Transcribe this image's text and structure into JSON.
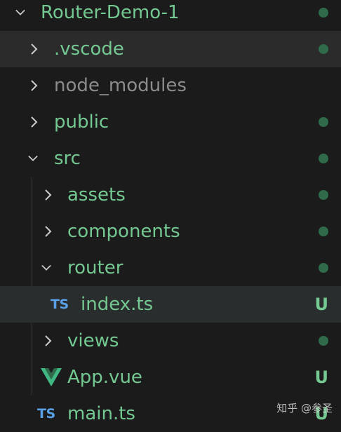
{
  "explorer": {
    "items": [
      {
        "label": "Router-Demo-1",
        "color": "#73c991",
        "status": "dot"
      },
      {
        "label": ".vscode",
        "color": "#73c991",
        "status": "dot"
      },
      {
        "label": "node_modules",
        "color": "#8c8c8c",
        "status": "none"
      },
      {
        "label": "public",
        "color": "#73c991",
        "status": "dot"
      },
      {
        "label": "src",
        "color": "#73c991",
        "status": "dot"
      },
      {
        "label": "assets",
        "color": "#73c991",
        "status": "dot"
      },
      {
        "label": "components",
        "color": "#73c991",
        "status": "dot"
      },
      {
        "label": "router",
        "color": "#73c991",
        "status": "dot"
      },
      {
        "label": "index.ts",
        "color": "#73c991",
        "status": "U",
        "icon": "TS"
      },
      {
        "label": "views",
        "color": "#73c991",
        "status": "dot"
      },
      {
        "label": "App.vue",
        "color": "#73c991",
        "status": "U"
      },
      {
        "label": "main.ts",
        "color": "#73c991",
        "status": "U",
        "icon": "TS"
      }
    ]
  },
  "watermark": "知乎 @参圣"
}
